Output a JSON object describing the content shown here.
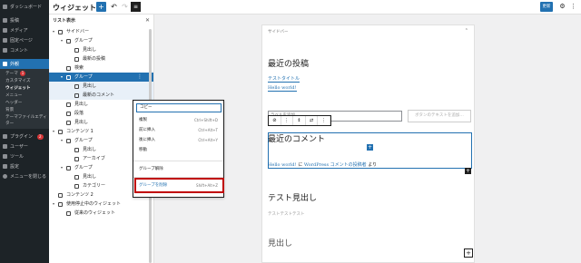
{
  "admin_menu": {
    "items": [
      {
        "label": "ダッシュボード"
      },
      {
        "label": "投稿"
      },
      {
        "label": "メディア"
      },
      {
        "label": "固定ページ"
      },
      {
        "label": "コメント"
      },
      {
        "label": "外観"
      }
    ],
    "sub": {
      "theme": "テーマ",
      "theme_badge": "1",
      "customize": "カスタマイズ",
      "widgets": "ウィジェット",
      "menus": "メニュー",
      "header": "ヘッダー",
      "background": "背景",
      "theme_editor": "テーマファイルエディター"
    },
    "items2": [
      {
        "label": "プラグイン",
        "badge": "2"
      },
      {
        "label": "ユーザー"
      },
      {
        "label": "ツール"
      },
      {
        "label": "設定"
      },
      {
        "label": "メニューを閉じる"
      }
    ]
  },
  "topbar": {
    "title": "ウィジェット",
    "add": "+",
    "undo": "↶",
    "redo": "↷",
    "list": "≡",
    "update": "更新",
    "settings": "⚙",
    "more": "⋮"
  },
  "listview": {
    "title": "リスト表示",
    "close": "✕",
    "rows": [
      {
        "label": "サイドバー"
      },
      {
        "label": "グループ"
      },
      {
        "label": "見出し"
      },
      {
        "label": "最新の投稿"
      },
      {
        "label": "検索"
      },
      {
        "label": "グループ"
      },
      {
        "label": "見出し"
      },
      {
        "label": "最新のコメント"
      },
      {
        "label": "見出し"
      },
      {
        "label": "段落"
      },
      {
        "label": "見出し"
      },
      {
        "label": "コンテンツ 1"
      },
      {
        "label": "グループ"
      },
      {
        "label": "見出し"
      },
      {
        "label": "アーカイブ"
      },
      {
        "label": "グループ"
      },
      {
        "label": "見出し"
      },
      {
        "label": "カテゴリー"
      },
      {
        "label": "コンテンツ 2"
      },
      {
        "label": "使用停止中のウィジェット"
      },
      {
        "label": "従来のウィジェット"
      }
    ]
  },
  "context_menu": {
    "copy": "コピー",
    "duplicate": "複製",
    "duplicate_sc": "Ctrl+Shift+D",
    "insert_before": "前に挿入",
    "insert_before_sc": "Ctrl+Alt+T",
    "insert_after": "後に挿入",
    "insert_after_sc": "Ctrl+Alt+Y",
    "move": "移動",
    "ungroup_label": "グループ解除",
    "remove_group": "グループを削除",
    "remove_group_sc": "Shift+Alt+Z"
  },
  "canvas": {
    "widget_area": "サイドバー",
    "toggle": "⌃",
    "recent_posts_heading": "最近の投稿",
    "recent_post_link": "テストタイトル",
    "recent_post_link2": "Hello world!",
    "label_placeholder": "ラベルを追加…",
    "search_button": "ボタンのテキストを追加…",
    "recent_comments_heading": "最近のコメント",
    "comment_link": "Hello world!",
    "comment_on": "に",
    "comment_author": "WordPress コメントの投稿者",
    "comment_tail": "より",
    "test_heading": "テスト見出し",
    "test_text": "テストテストテスト",
    "heading_placeholder": "見出し",
    "add_block": "+",
    "inserter": "+"
  }
}
